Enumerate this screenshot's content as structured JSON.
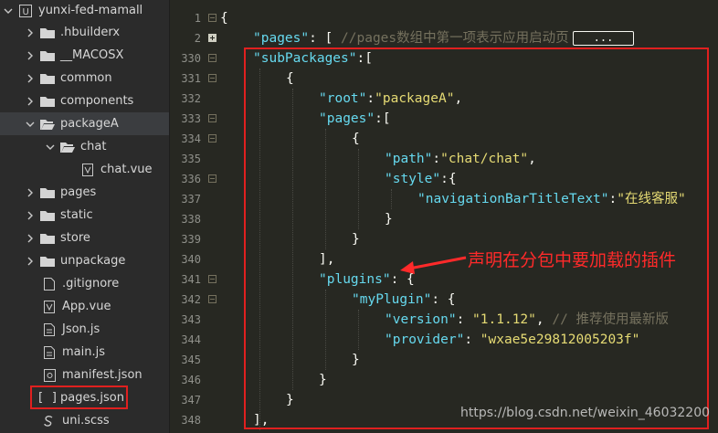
{
  "sidebar": {
    "project": "yunxi-fed-mamall",
    "items": [
      {
        "label": ".hbuilderx",
        "type": "folder"
      },
      {
        "label": "__MACOSX",
        "type": "folder"
      },
      {
        "label": "common",
        "type": "folder"
      },
      {
        "label": "components",
        "type": "folder"
      },
      {
        "label": "packageA",
        "type": "folder-open",
        "selected": true
      },
      {
        "label": "chat",
        "type": "folder-open"
      },
      {
        "label": "chat.vue",
        "type": "vue"
      },
      {
        "label": "pages",
        "type": "folder"
      },
      {
        "label": "static",
        "type": "folder"
      },
      {
        "label": "store",
        "type": "folder"
      },
      {
        "label": "unpackage",
        "type": "folder"
      },
      {
        "label": ".gitignore",
        "type": "file"
      },
      {
        "label": "App.vue",
        "type": "vue"
      },
      {
        "label": "Json.js",
        "type": "js"
      },
      {
        "label": "main.js",
        "type": "js"
      },
      {
        "label": "manifest.json",
        "type": "settings"
      },
      {
        "label": "pages.json",
        "type": "json",
        "highlighted": true
      },
      {
        "label": "uni.scss",
        "type": "scss"
      }
    ]
  },
  "editor": {
    "line_numbers": [
      "1",
      "2",
      "330",
      "331",
      "332",
      "333",
      "334",
      "335",
      "336",
      "337",
      "338",
      "339",
      "340",
      "341",
      "342",
      "343",
      "344",
      "345",
      "346",
      "347",
      "348"
    ],
    "lines": {
      "l1": "{",
      "l2_key": "\"pages\"",
      "l2_rest": ": [ ",
      "l2_comment": "//pages数组中第一项表示应用启动页",
      "l2_fold": "...",
      "l330_key": "\"subPackages\"",
      "l330_rest": ":[",
      "l331": "{",
      "l332_key": "\"root\"",
      "l332_colon": ":",
      "l332_val": "\"packageA\"",
      "l332_end": ",",
      "l333_key": "\"pages\"",
      "l333_rest": ":[",
      "l334": "{",
      "l335_key": "\"path\"",
      "l335_colon": ":",
      "l335_val": "\"chat/chat\"",
      "l335_end": ",",
      "l336_key": "\"style\"",
      "l336_rest": ":{",
      "l337_key": "\"navigationBarTitleText\"",
      "l337_colon": ":",
      "l337_val": "\"在线客服\"",
      "l338": "}",
      "l339": "}",
      "l340": "],",
      "l341_key": "\"plugins\"",
      "l341_rest": ": {",
      "l342_key": "\"myPlugin\"",
      "l342_rest": ": {",
      "l343_key": "\"version\"",
      "l343_colon": ": ",
      "l343_val": "\"1.1.12\"",
      "l343_end": ", ",
      "l343_comment": "// 推荐使用最新版",
      "l344_key": "\"provider\"",
      "l344_colon": ": ",
      "l344_val": "\"wxae5e29812005203f\"",
      "l345": "}",
      "l346": "}",
      "l347": "}",
      "l348": "],"
    }
  },
  "annotation": "声明在分包中要加载的插件",
  "watermark": "https://blog.csdn.net/weixin_46032200",
  "colors": {
    "highlight_border": "#e0201f",
    "annotation": "#ff2a2a",
    "key": "#66d9ef",
    "string": "#e6db74",
    "comment": "#75715e"
  }
}
